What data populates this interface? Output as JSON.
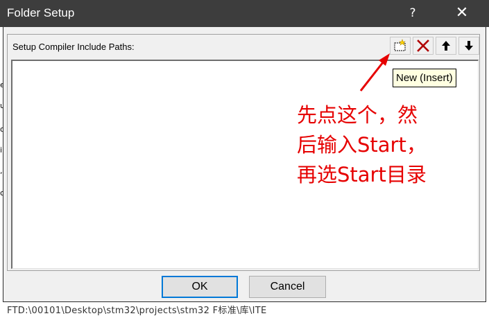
{
  "window": {
    "title": "Folder Setup",
    "help_label": "?",
    "close_label": "✕"
  },
  "group": {
    "label": "Setup Compiler Include Paths:"
  },
  "toolbar": {
    "buttons": [
      {
        "name": "new-insert",
        "icon": "new-folder-icon"
      },
      {
        "name": "delete",
        "icon": "delete-x-icon"
      },
      {
        "name": "move-up",
        "icon": "arrow-up-icon"
      },
      {
        "name": "move-down",
        "icon": "arrow-down-icon"
      }
    ]
  },
  "list": {
    "items": []
  },
  "tooltip": {
    "text": "New (Insert)"
  },
  "annotation": {
    "lines": [
      "先点这个，然",
      "后输入Start，",
      "再选Start目录"
    ],
    "color": "#e60000"
  },
  "buttons": {
    "ok_label": "OK",
    "cancel_label": "Cancel"
  },
  "background": {
    "bottom_text": "FTD:\\00101\\Desktop\\stm32\\projects\\stm32 F标准\\库\\ITE"
  }
}
